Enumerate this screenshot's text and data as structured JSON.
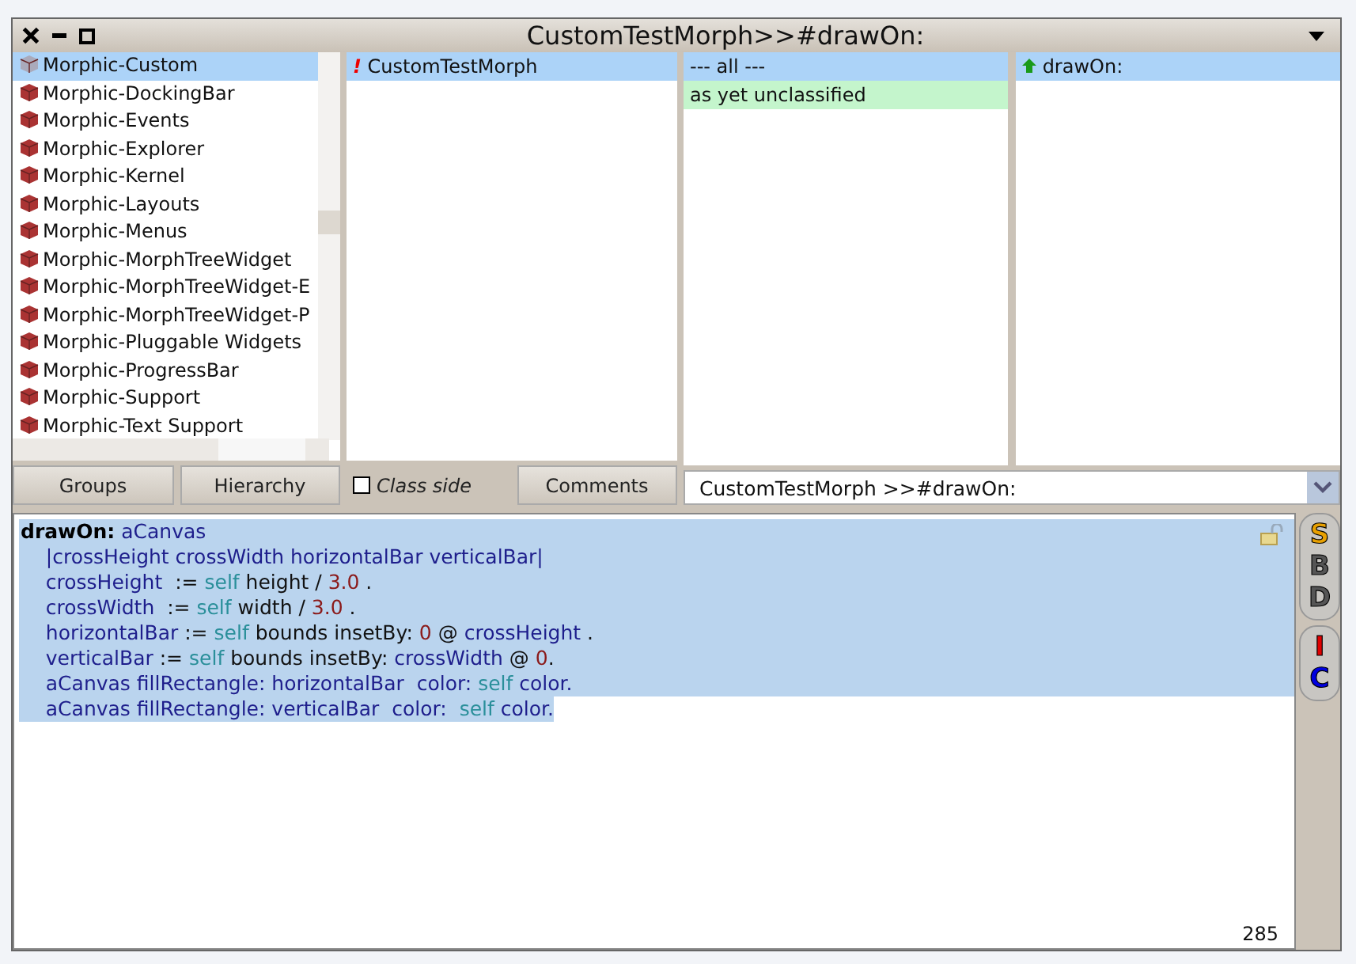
{
  "window": {
    "title": "CustomTestMorph>>#drawOn:"
  },
  "packages": {
    "items": [
      {
        "label": "Morphic-Custom",
        "selected": true
      },
      {
        "label": "Morphic-DockingBar",
        "selected": false
      },
      {
        "label": "Morphic-Events",
        "selected": false
      },
      {
        "label": "Morphic-Explorer",
        "selected": false
      },
      {
        "label": "Morphic-Kernel",
        "selected": false
      },
      {
        "label": "Morphic-Layouts",
        "selected": false
      },
      {
        "label": "Morphic-Menus",
        "selected": false
      },
      {
        "label": "Morphic-MorphTreeWidget",
        "selected": false
      },
      {
        "label": "Morphic-MorphTreeWidget-E",
        "selected": false
      },
      {
        "label": "Morphic-MorphTreeWidget-P",
        "selected": false
      },
      {
        "label": "Morphic-Pluggable Widgets",
        "selected": false
      },
      {
        "label": "Morphic-ProgressBar",
        "selected": false
      },
      {
        "label": "Morphic-Support",
        "selected": false
      },
      {
        "label": "Morphic-Text Support",
        "selected": false
      }
    ]
  },
  "classes": {
    "items": [
      {
        "label": "CustomTestMorph",
        "mark": "!",
        "selected": true
      }
    ]
  },
  "protocols": {
    "items": [
      {
        "label": "--- all ---",
        "kind": "all",
        "selected": true
      },
      {
        "label": "as yet unclassified",
        "kind": "category",
        "selected": false
      }
    ]
  },
  "methods": {
    "items": [
      {
        "label": "drawOn:",
        "selected": true
      }
    ]
  },
  "buttons": [
    {
      "label": "Groups"
    },
    {
      "label": "Hierarchy"
    }
  ],
  "class_side": {
    "label": "Class side",
    "checked": false
  },
  "comments_button": {
    "label": "Comments"
  },
  "method_field": {
    "value": "CustomTestMorph >>#drawOn:"
  },
  "code": {
    "lines": [
      [
        {
          "text": "drawOn:",
          "kind": "sel"
        },
        {
          "text": " aCanvas",
          "kind": "id"
        }
      ],
      [
        {
          "text": "    |crossHeight crossWidth horizontalBar verticalBar|",
          "kind": "id"
        }
      ],
      [
        {
          "text": "    crossHeight ",
          "kind": "id"
        },
        {
          "text": " := ",
          "kind": "op"
        },
        {
          "text": "self",
          "kind": "self"
        },
        {
          "text": " height / ",
          "kind": "op"
        },
        {
          "text": "3.0",
          "kind": "num"
        },
        {
          "text": " .",
          "kind": "op"
        }
      ],
      [
        {
          "text": "    crossWidth ",
          "kind": "id"
        },
        {
          "text": " := ",
          "kind": "op"
        },
        {
          "text": "self",
          "kind": "self"
        },
        {
          "text": " width / ",
          "kind": "op"
        },
        {
          "text": "3.0",
          "kind": "num"
        },
        {
          "text": " .",
          "kind": "op"
        }
      ],
      [
        {
          "text": "    horizontalBar",
          "kind": "id"
        },
        {
          "text": " := ",
          "kind": "op"
        },
        {
          "text": "self",
          "kind": "self"
        },
        {
          "text": " bounds insetBy: ",
          "kind": "op"
        },
        {
          "text": "0",
          "kind": "num"
        },
        {
          "text": " @ ",
          "kind": "op"
        },
        {
          "text": "crossHeight",
          "kind": "id"
        },
        {
          "text": " .",
          "kind": "op"
        }
      ],
      [
        {
          "text": "    verticalBar",
          "kind": "id"
        },
        {
          "text": " := ",
          "kind": "op"
        },
        {
          "text": "self",
          "kind": "self"
        },
        {
          "text": " bounds insetBy: ",
          "kind": "op"
        },
        {
          "text": "crossWidth",
          "kind": "id"
        },
        {
          "text": " @ ",
          "kind": "op"
        },
        {
          "text": "0",
          "kind": "num"
        },
        {
          "text": ".",
          "kind": "op"
        }
      ],
      [
        {
          "text": "    aCanvas fillRectangle: horizontalBar  color: ",
          "kind": "id"
        },
        {
          "text": "self",
          "kind": "self"
        },
        {
          "text": " color.",
          "kind": "id"
        }
      ],
      [
        {
          "text": "    aCanvas fillRectangle: verticalBar  color:  ",
          "kind": "id"
        },
        {
          "text": "self",
          "kind": "self"
        },
        {
          "text": " color.",
          "kind": "id"
        }
      ]
    ],
    "selected": true,
    "char_count": "285"
  },
  "side_buttons": [
    {
      "label": "S",
      "color": "#e8a000"
    },
    {
      "label": "B",
      "color": "#555555"
    },
    {
      "label": "D",
      "color": "#555555"
    },
    {
      "label": "I",
      "color": "#e00000"
    },
    {
      "label": "C",
      "color": "#0000e0"
    }
  ]
}
